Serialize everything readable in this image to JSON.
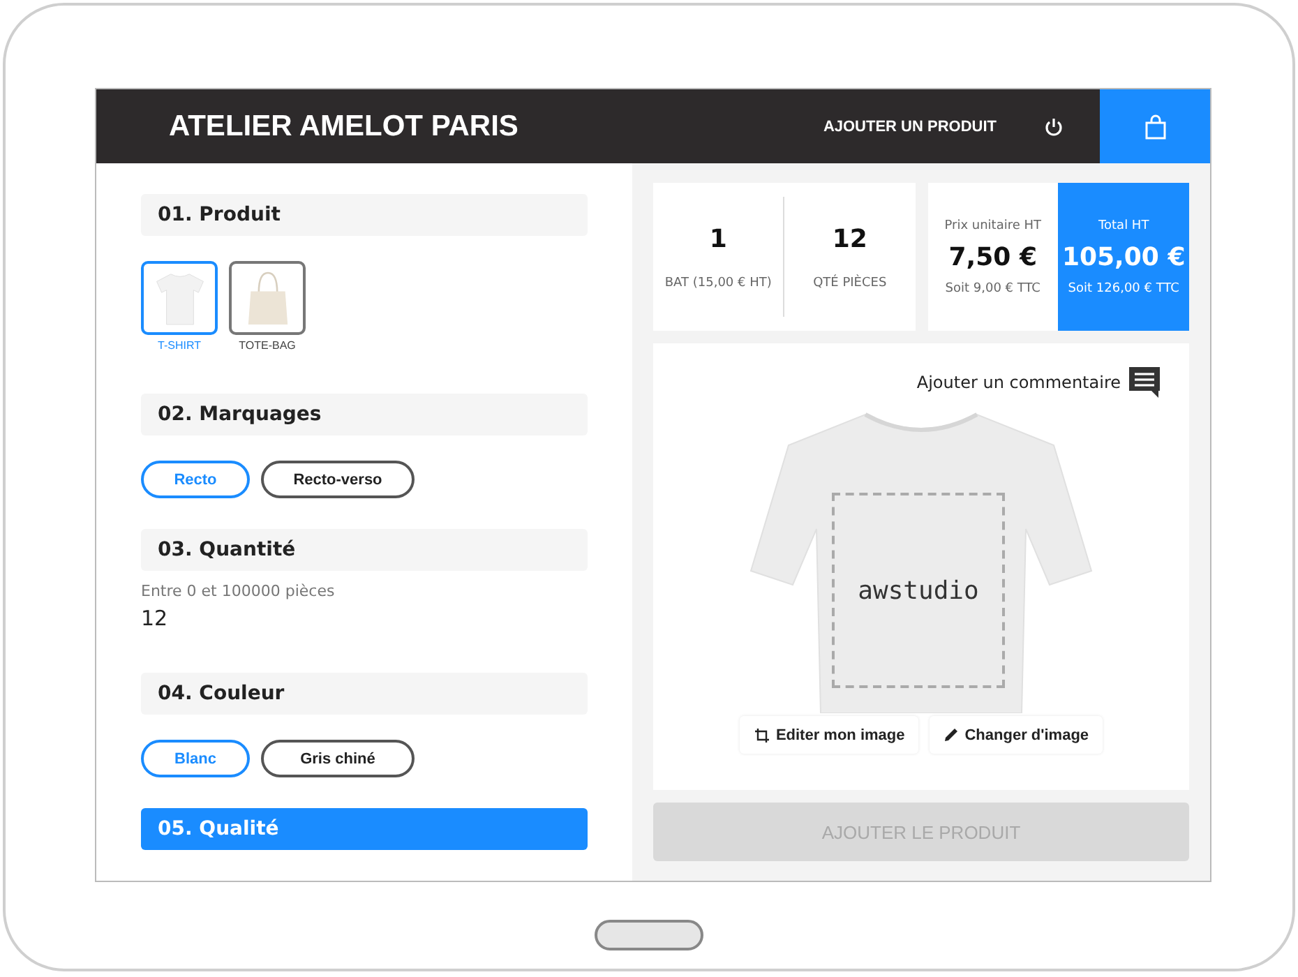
{
  "header": {
    "brand": "ATELIER AMELOT PARIS",
    "add_product": "AJOUTER UN PRODUIT"
  },
  "sections": [
    {
      "kind": "products",
      "title": "01. Produit",
      "active": false,
      "items": [
        {
          "label": "T-SHIRT",
          "selected": true,
          "kind": "tshirt"
        },
        {
          "label": "TOTE-BAG",
          "selected": false,
          "kind": "tote"
        }
      ]
    },
    {
      "kind": "pills",
      "title": "02. Marquages",
      "active": false,
      "items": [
        {
          "label": "Recto",
          "selected": true
        },
        {
          "label": "Recto-verso",
          "selected": false
        }
      ]
    },
    {
      "kind": "quantity",
      "title": "03. Quantité",
      "active": false,
      "hint": "Entre 0 et 100000 pièces",
      "value": "12"
    },
    {
      "kind": "pills",
      "title": "04. Couleur",
      "active": false,
      "items": [
        {
          "label": "Blanc",
          "selected": true
        },
        {
          "label": "Gris chiné",
          "selected": false
        }
      ]
    },
    {
      "kind": "header",
      "title": "05. Qualité",
      "active": true
    }
  ],
  "summary": {
    "bat": {
      "value": "1",
      "label": "BAT (15,00 € HT)"
    },
    "pieces": {
      "value": "12",
      "label": "QTÉ PIÈCES"
    },
    "unit": {
      "label": "Prix unitaire HT",
      "value": "7,50 €",
      "ttc": "Soit 9,00 € TTC"
    },
    "total": {
      "label": "Total HT",
      "value": "105,00 €",
      "ttc": "Soit 126,00 € TTC"
    }
  },
  "preview": {
    "comment": "Ajouter un commentaire",
    "design_text": "awstudio",
    "edit": "Editer mon image",
    "change": "Changer d'image"
  },
  "add_button": {
    "label": "AJOUTER LE PRODUIT",
    "disabled": true
  }
}
